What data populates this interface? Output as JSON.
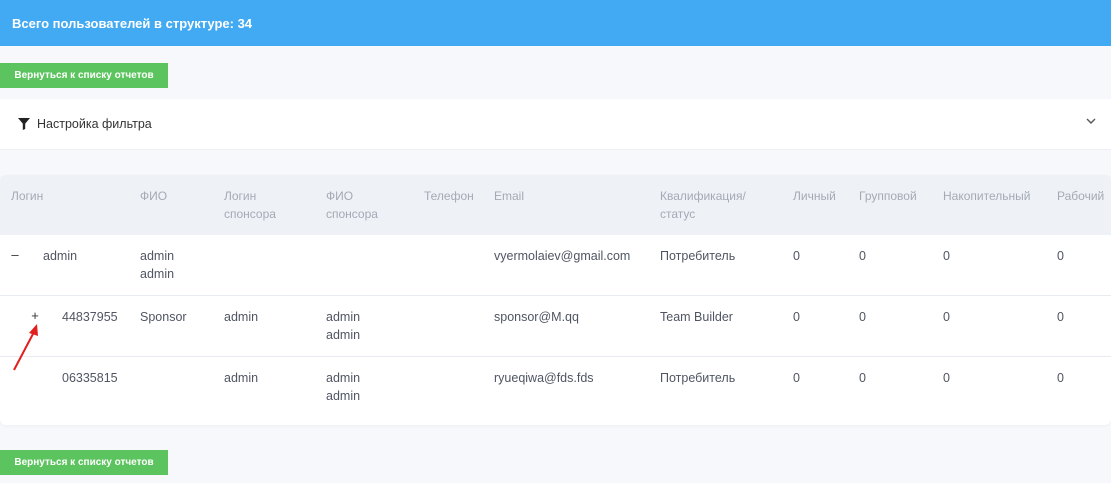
{
  "header": {
    "title": "Всего пользователей в структуре: 34"
  },
  "actions": {
    "back_label": "Вернуться к списку отчетов"
  },
  "filter": {
    "title": "Настройка фильтра"
  },
  "table": {
    "columns": [
      {
        "line1": "",
        "line2": "Логин"
      },
      {
        "line1": "",
        "line2": "ФИО"
      },
      {
        "line1": "Логин",
        "line2": "спонсора"
      },
      {
        "line1": "ФИО",
        "line2": "спонсора"
      },
      {
        "line1": "",
        "line2": "Телефон"
      },
      {
        "line1": "",
        "line2": "Email"
      },
      {
        "line1": "Квалификация/",
        "line2": "статус"
      },
      {
        "line1": "",
        "line2": "Личный"
      },
      {
        "line1": "",
        "line2": "Групповой"
      },
      {
        "line1": "",
        "line2": "Накопительный"
      },
      {
        "line1": "",
        "line2": "Рабочий"
      }
    ],
    "rows": [
      {
        "toggle": "–",
        "login": "admin",
        "fio1": "admin",
        "fio2": "admin",
        "sponsor_login": "",
        "sponsor_fio1": "",
        "sponsor_fio2": "",
        "phone": "",
        "email": "vyermolaiev@gmail.com",
        "status": "Потребитель",
        "personal": "0",
        "group": "0",
        "cumulative": "0",
        "working": "0"
      },
      {
        "toggle": "+",
        "login": "44837955",
        "fio1": "Sponsor",
        "fio2": "",
        "sponsor_login": "admin",
        "sponsor_fio1": "admin",
        "sponsor_fio2": "admin",
        "phone": "",
        "email": "sponsor@M.qq",
        "status": "Team Builder",
        "personal": "0",
        "group": "0",
        "cumulative": "0",
        "working": "0"
      },
      {
        "toggle": "",
        "login": "06335815",
        "fio1": "",
        "fio2": "",
        "sponsor_login": "admin",
        "sponsor_fio1": "admin",
        "sponsor_fio2": "admin",
        "phone": "",
        "email": "ryueqiwa@fds.fds",
        "status": "Потребитель",
        "personal": "0",
        "group": "0",
        "cumulative": "0",
        "working": "0"
      }
    ]
  },
  "colors": {
    "header_bg": "#42a9f3",
    "button_bg": "#5cc45f",
    "annotation_arrow": "#e0201f"
  }
}
